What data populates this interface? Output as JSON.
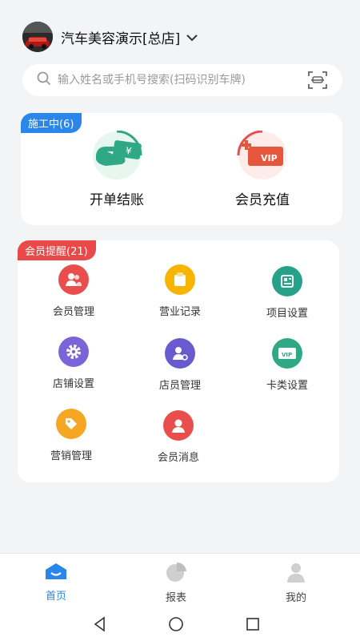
{
  "header": {
    "store_name": "汽车美容演示[总店]"
  },
  "search": {
    "placeholder": "输入姓名或手机号搜索(扫码识别车牌)"
  },
  "construction": {
    "tag": "施工中(6)",
    "actions": [
      {
        "label": "开单结账",
        "icon": "checkout-cash-icon"
      },
      {
        "label": "会员充值",
        "icon": "vip-recharge-icon"
      }
    ]
  },
  "member_reminders": {
    "tag": "会员提醒(21)",
    "items": [
      {
        "label": "会员管理",
        "icon": "member-management-icon",
        "color": "#e94d4c"
      },
      {
        "label": "营业记录",
        "icon": "business-record-icon",
        "color": "#f7b500"
      },
      {
        "label": "项目设置",
        "icon": "project-settings-icon",
        "color": "#27a28a"
      },
      {
        "label": "店铺设置",
        "icon": "store-settings-icon",
        "color": "#7a64d7"
      },
      {
        "label": "店员管理",
        "icon": "staff-management-icon",
        "color": "#6a5ad0"
      },
      {
        "label": "卡类设置",
        "icon": "card-settings-icon",
        "color": "#2fa885"
      },
      {
        "label": "营销管理",
        "icon": "marketing-icon",
        "color": "#f5a623"
      },
      {
        "label": "会员消息",
        "icon": "member-message-icon",
        "color": "#e94d4c"
      }
    ]
  },
  "tabbar": {
    "tabs": [
      {
        "label": "首页",
        "icon": "home-icon",
        "active": true
      },
      {
        "label": "报表",
        "icon": "pie-chart-icon",
        "active": false
      },
      {
        "label": "我的",
        "icon": "profile-icon",
        "active": false
      }
    ]
  },
  "colors": {
    "accent": "#2a86ea",
    "reminder": "#e94a49",
    "inactive": "#bfbfbf"
  }
}
